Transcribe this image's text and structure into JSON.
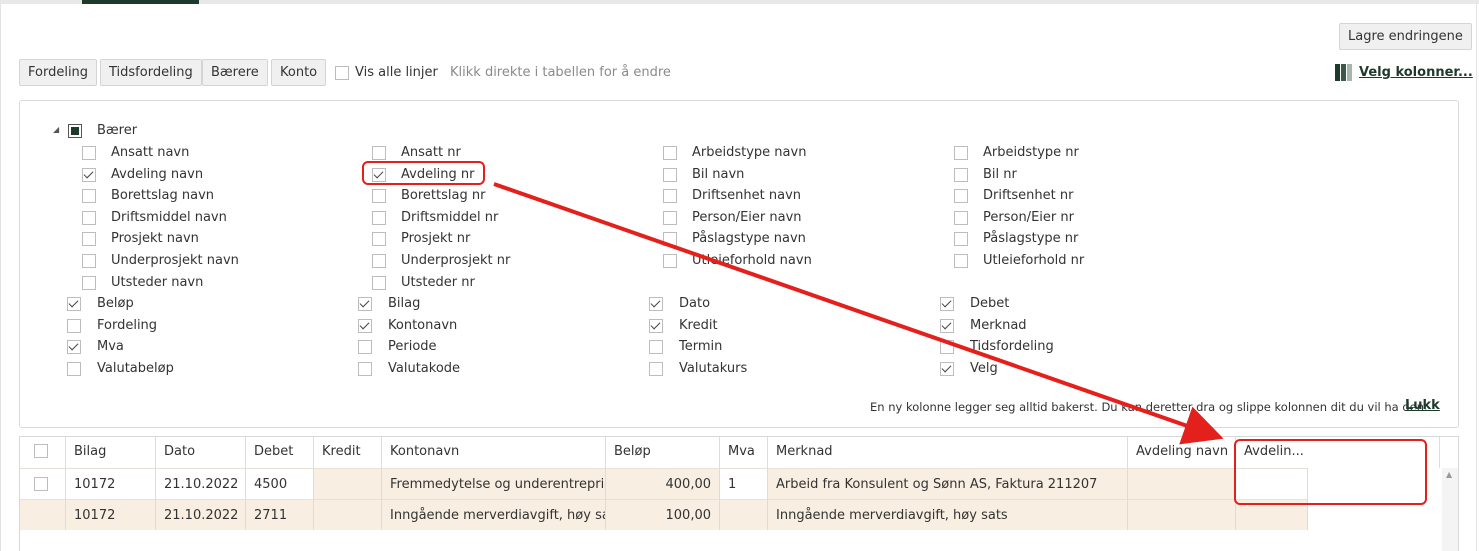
{
  "toolbar": {
    "save_label": "Lagre endringene",
    "fordeling": "Fordeling",
    "tidsfordeling": "Tidsfordeling",
    "baerere": "Bærere",
    "konto": "Konto",
    "show_all_lines": "Vis alle linjer",
    "hint": "Klikk direkte i tabellen for å endre",
    "choose_columns": "Velg kolonner..."
  },
  "column_chooser": {
    "group_label": "Bærer",
    "group_items": [
      {
        "label": "Ansatt navn",
        "checked": false
      },
      {
        "label": "Ansatt nr",
        "checked": false
      },
      {
        "label": "Arbeidstype navn",
        "checked": false
      },
      {
        "label": "Arbeidstype nr",
        "checked": false
      },
      {
        "label": "Avdeling navn",
        "checked": true
      },
      {
        "label": "Avdeling nr",
        "checked": true
      },
      {
        "label": "Bil navn",
        "checked": false
      },
      {
        "label": "Bil nr",
        "checked": false
      },
      {
        "label": "Borettslag navn",
        "checked": false
      },
      {
        "label": "Borettslag nr",
        "checked": false
      },
      {
        "label": "Driftsenhet navn",
        "checked": false
      },
      {
        "label": "Driftsenhet nr",
        "checked": false
      },
      {
        "label": "Driftsmiddel navn",
        "checked": false
      },
      {
        "label": "Driftsmiddel nr",
        "checked": false
      },
      {
        "label": "Person/Eier navn",
        "checked": false
      },
      {
        "label": "Person/Eier nr",
        "checked": false
      },
      {
        "label": "Prosjekt navn",
        "checked": false
      },
      {
        "label": "Prosjekt nr",
        "checked": false
      },
      {
        "label": "Påslagstype navn",
        "checked": false
      },
      {
        "label": "Påslagstype nr",
        "checked": false
      },
      {
        "label": "Underprosjekt navn",
        "checked": false
      },
      {
        "label": "Underprosjekt nr",
        "checked": false
      },
      {
        "label": "Utleieforhold navn",
        "checked": false
      },
      {
        "label": "Utleieforhold nr",
        "checked": false
      },
      {
        "label": "Utsteder navn",
        "checked": false
      },
      {
        "label": "Utsteder nr",
        "checked": false
      }
    ],
    "main_items": [
      {
        "label": "Beløp",
        "checked": true
      },
      {
        "label": "Bilag",
        "checked": true
      },
      {
        "label": "Dato",
        "checked": true
      },
      {
        "label": "Debet",
        "checked": true
      },
      {
        "label": "Fordeling",
        "checked": false
      },
      {
        "label": "Kontonavn",
        "checked": true
      },
      {
        "label": "Kredit",
        "checked": true
      },
      {
        "label": "Merknad",
        "checked": true
      },
      {
        "label": "Mva",
        "checked": true
      },
      {
        "label": "Periode",
        "checked": false
      },
      {
        "label": "Termin",
        "checked": false
      },
      {
        "label": "Tidsfordeling",
        "checked": false
      },
      {
        "label": "Valutabeløp",
        "checked": false
      },
      {
        "label": "Valutakode",
        "checked": false
      },
      {
        "label": "Valutakurs",
        "checked": false
      },
      {
        "label": "Velg",
        "checked": true
      }
    ],
    "footer_note": "En ny kolonne legger seg alltid bakerst. Du kan deretter dra og slippe kolonnen dit du vil ha den.",
    "close_label": "Lukk"
  },
  "table": {
    "headers": [
      "Bilag",
      "Dato",
      "Debet",
      "Kredit",
      "Kontonavn",
      "Beløp",
      "Mva",
      "Merknad",
      "Avdeling navn",
      "Avdelin..."
    ],
    "rows": [
      [
        "10172",
        "21.10.2022",
        "4500",
        "",
        "Fremmedytelse og underentreprise",
        "400,00",
        "1",
        "Arbeid fra Konsulent og Sønn AS, Faktura 211207",
        "",
        ""
      ],
      [
        "10172",
        "21.10.2022",
        "2711",
        "",
        "Inngående merverdiavgift, høy sats",
        "100,00",
        "",
        "Inngående merverdiavgift, høy sats",
        "",
        ""
      ]
    ]
  },
  "colors": {
    "accent": "#1e3a2c",
    "row_fill": "#f8efe2",
    "annotation": "#e3201b"
  }
}
